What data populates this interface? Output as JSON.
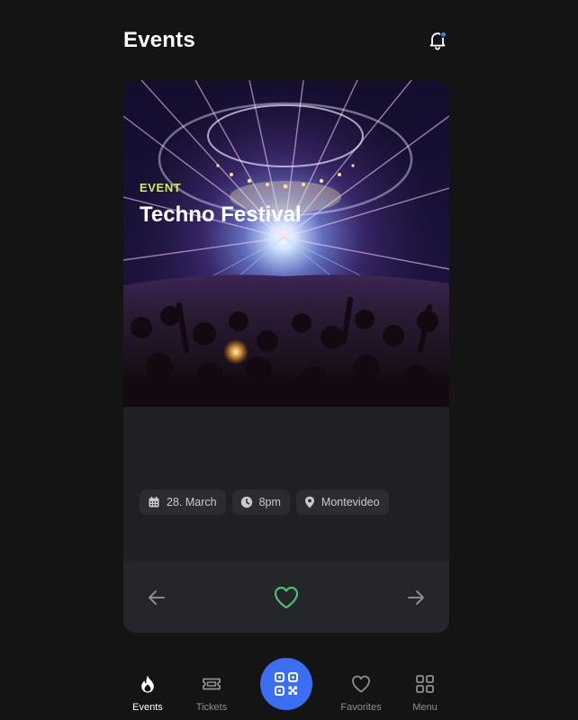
{
  "header": {
    "title": "Events",
    "icons": {
      "notifications": "bell-icon"
    },
    "notification_dot_color": "#3b82f6"
  },
  "event_card": {
    "image_alt": "Concert crowd under bright stage lights",
    "category": "EVENT",
    "title": "Techno Festival",
    "date": "28. March",
    "time": "8pm",
    "location": "Montevideo",
    "category_color": "#d4e86a",
    "favorite_color": "#4fbf6e",
    "favorited": false,
    "icons": {
      "date": "calendar-icon",
      "time": "clock-icon",
      "location": "map-pin-icon",
      "previous": "arrow-left-icon",
      "next": "arrow-right-icon",
      "favorite": "heart-icon"
    }
  },
  "tabbar": {
    "accent_color": "#3b6ef2",
    "items": [
      {
        "label": "Events",
        "icon": "flame-icon",
        "active": true
      },
      {
        "label": "Tickets",
        "icon": "ticket-icon",
        "active": false
      },
      {
        "label": "",
        "icon": "qr-code-icon",
        "active": false
      },
      {
        "label": "Favorites",
        "icon": "heart-icon",
        "active": false
      },
      {
        "label": "Menu",
        "icon": "grid-icon",
        "active": false
      }
    ]
  }
}
